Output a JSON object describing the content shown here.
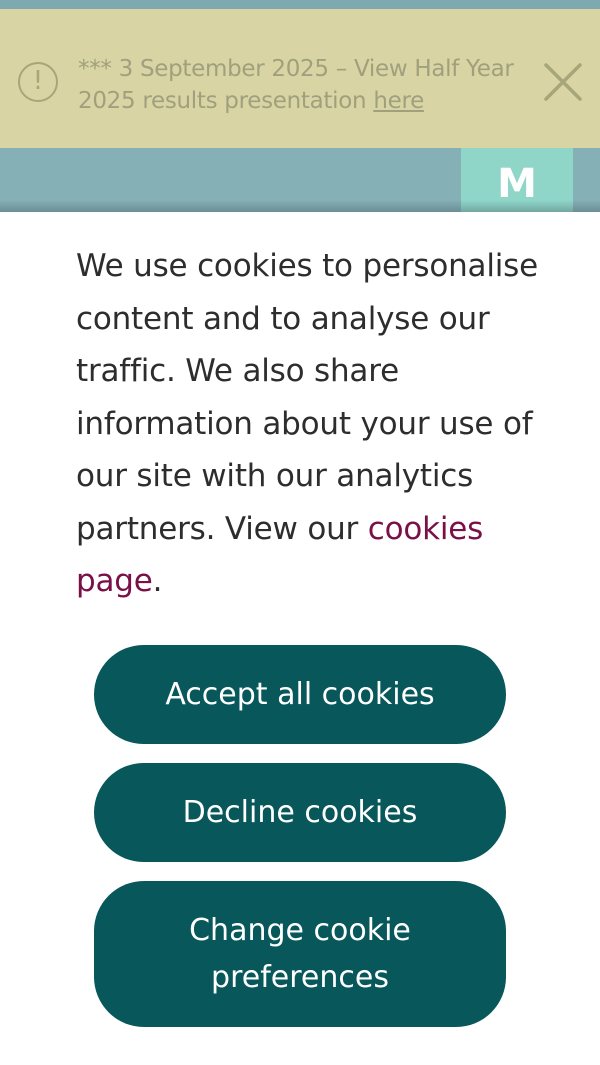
{
  "alert": {
    "icon": "exclamation-circle-icon",
    "text": "*** 3 September 2025 – View Half Year 2025 results presentation ",
    "link_label": "here",
    "close_icon": "close-icon"
  },
  "background": {
    "logo_letter": "M"
  },
  "cookie_banner": {
    "message": "We use cookies to personalise content and to analyse our traffic. We also share information about your use of our site with our analytics partners. View our ",
    "link_label": "cookies page",
    "message_end": ".",
    "accept_label": "Accept all cookies",
    "decline_label": "Decline cookies",
    "change_label": "Change cookie preferences"
  },
  "colors": {
    "alert_bg": "#d9d4a3",
    "alert_text": "#a1a07e",
    "header_bg": "#84b0b6",
    "logo_bg": "#8fd6c9",
    "button_bg": "#07575b",
    "link": "#7a1048"
  }
}
